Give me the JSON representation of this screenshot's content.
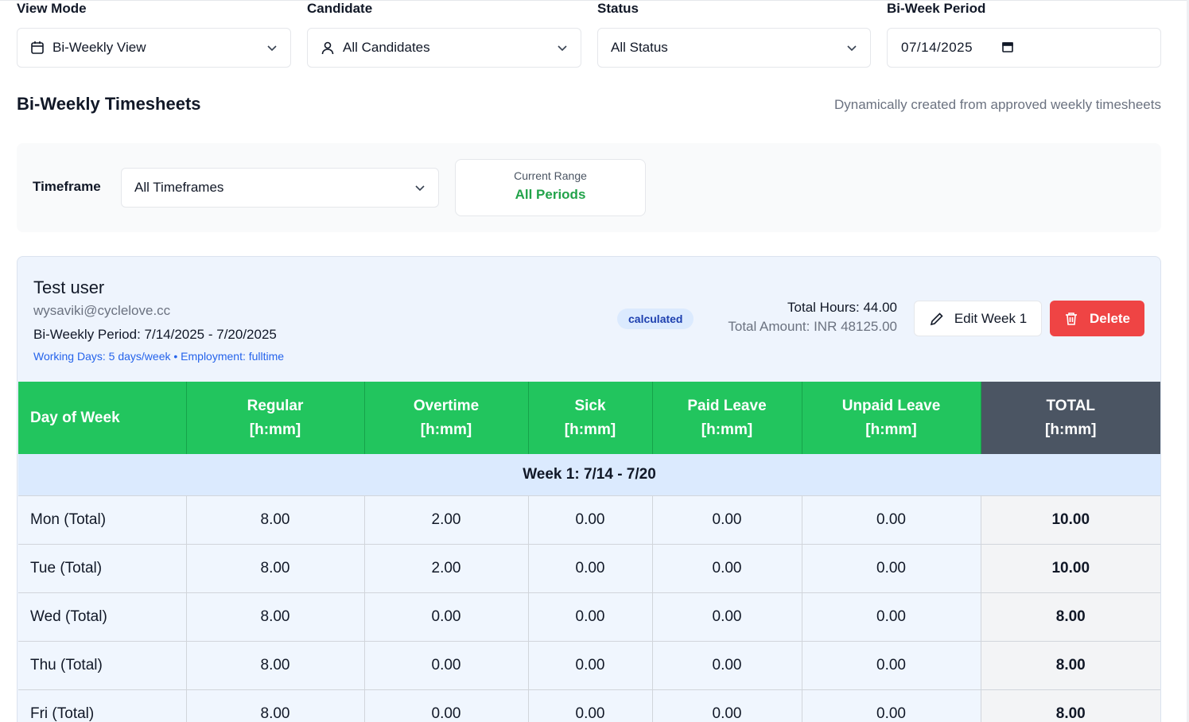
{
  "filters": [
    {
      "label": "View Mode",
      "value": "Bi-Weekly View",
      "icon": "calendar-icon"
    },
    {
      "label": "Candidate",
      "value": "All Candidates",
      "icon": "user-icon"
    },
    {
      "label": "Status",
      "value": "All Status",
      "icon": ""
    },
    {
      "label": "Bi-Week Period",
      "value": "07/14/2025",
      "icon": "date-picker-icon"
    }
  ],
  "section": {
    "title": "Bi-Weekly Timesheets",
    "subtitle": "Dynamically created from approved weekly timesheets"
  },
  "timeframe": {
    "label": "Timeframe",
    "value": "All Timeframes",
    "range_label": "Current Range",
    "range_value": "All Periods"
  },
  "card": {
    "name": "Test user",
    "email": "wysaviki@cyclelove.cc",
    "period": "Bi-Weekly Period: 7/14/2025 - 7/20/2025",
    "meta": "Working Days: 5 days/week • Employment: fulltime",
    "badge": "calculated",
    "total_hours": "Total Hours: 44.00",
    "total_amount": "Total Amount: INR 48125.00",
    "edit_label": "Edit Week 1",
    "delete_label": "Delete"
  },
  "table": {
    "headers": [
      {
        "line1": "Day of Week",
        "line2": ""
      },
      {
        "line1": "Regular",
        "line2": "[h:mm]"
      },
      {
        "line1": "Overtime",
        "line2": "[h:mm]"
      },
      {
        "line1": "Sick",
        "line2": "[h:mm]"
      },
      {
        "line1": "Paid Leave",
        "line2": "[h:mm]"
      },
      {
        "line1": "Unpaid Leave",
        "line2": "[h:mm]"
      },
      {
        "line1": "TOTAL",
        "line2": "[h:mm]"
      }
    ],
    "week_label": "Week 1: 7/14 - 7/20",
    "rows": [
      [
        "Mon (Total)",
        "8.00",
        "2.00",
        "0.00",
        "0.00",
        "0.00",
        "10.00"
      ],
      [
        "Tue (Total)",
        "8.00",
        "2.00",
        "0.00",
        "0.00",
        "0.00",
        "10.00"
      ],
      [
        "Wed (Total)",
        "8.00",
        "0.00",
        "0.00",
        "0.00",
        "0.00",
        "8.00"
      ],
      [
        "Thu (Total)",
        "8.00",
        "0.00",
        "0.00",
        "0.00",
        "0.00",
        "8.00"
      ],
      [
        "Fri (Total)",
        "8.00",
        "0.00",
        "0.00",
        "0.00",
        "0.00",
        "8.00"
      ]
    ]
  },
  "colors": {
    "header_green": "#22c55e",
    "total_header": "#4b5563",
    "delete_red": "#ef4444",
    "range_green": "#22a34a",
    "meta_blue": "#2563eb"
  }
}
